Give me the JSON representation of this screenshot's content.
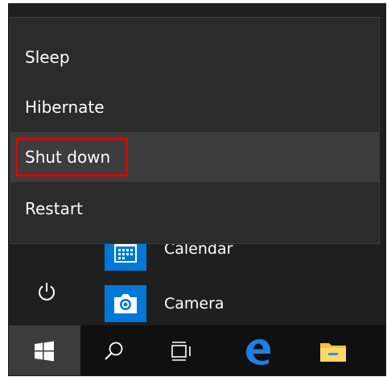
{
  "power_menu": {
    "items": [
      {
        "label": "Sleep"
      },
      {
        "label": "Hibernate"
      },
      {
        "label": "Shut down",
        "highlighted": true
      },
      {
        "label": "Restart"
      }
    ],
    "highlight_color": "#e00000"
  },
  "app_list": {
    "items": [
      {
        "label": "Calendar",
        "icon": "calendar-icon"
      },
      {
        "label": "Camera",
        "icon": "camera-icon"
      }
    ],
    "tile_color": "#0078d7"
  },
  "left_rail": {
    "power_icon": "power-icon"
  },
  "taskbar": {
    "items": [
      {
        "name": "start",
        "icon": "windows-logo-icon"
      },
      {
        "name": "search",
        "icon": "search-icon"
      },
      {
        "name": "task-view",
        "icon": "task-view-icon"
      },
      {
        "name": "edge",
        "icon": "edge-icon"
      },
      {
        "name": "file-explorer",
        "icon": "folder-icon"
      }
    ],
    "edge_color": "#1e7ee6",
    "folder_color": "#f5c33b"
  }
}
